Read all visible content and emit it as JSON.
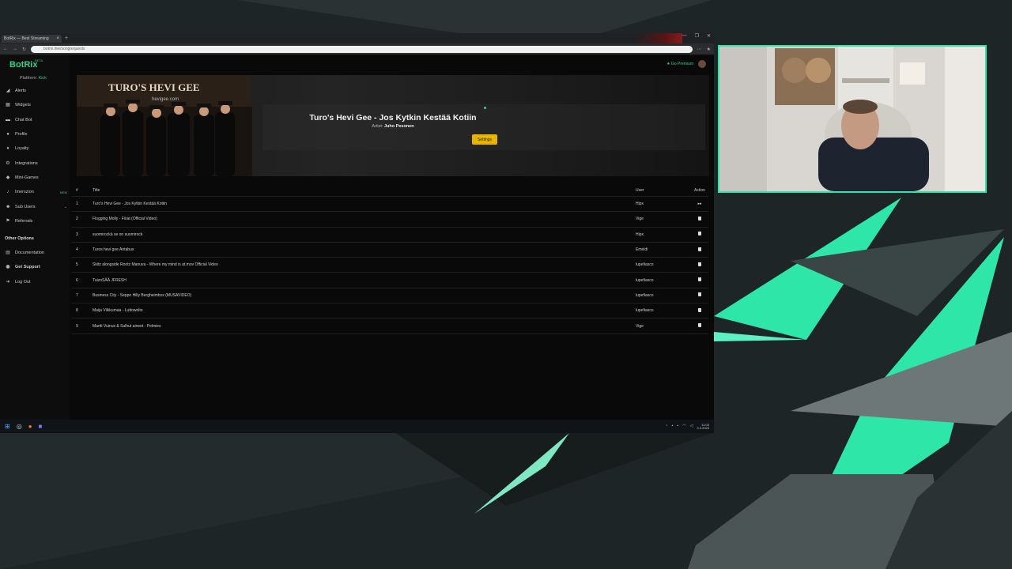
{
  "browser": {
    "tab_title": "BotRix — Best Streaming",
    "url": "botrix.live/songrequests",
    "new_tab": "+",
    "window_controls": [
      "—",
      "❐",
      "✕"
    ]
  },
  "app": {
    "logo": "BotRix",
    "beta": "BETA",
    "platform_label": "Platform:",
    "platform_value": "Kick",
    "go_premium": "★ Go Premium",
    "nav": [
      {
        "label": "Alerts",
        "icon": "megaphone-icon",
        "glyph": "◢"
      },
      {
        "label": "Widgets",
        "icon": "widgets-icon",
        "glyph": "▦"
      },
      {
        "label": "Chat Bot",
        "icon": "chat-icon",
        "glyph": "▬"
      },
      {
        "label": "Profile",
        "icon": "profile-icon",
        "glyph": "●"
      },
      {
        "label": "Loyalty",
        "icon": "loyalty-icon",
        "glyph": "♦"
      },
      {
        "label": "Integrations",
        "icon": "integrations-icon",
        "glyph": "⚙"
      },
      {
        "label": "Mini-Games",
        "icon": "gamepad-icon",
        "glyph": "◆"
      },
      {
        "label": "Imerszion",
        "icon": "music-icon",
        "glyph": "♪",
        "badge": "NEW"
      },
      {
        "label": "Sub Users",
        "icon": "users-icon",
        "glyph": "☻"
      },
      {
        "label": "Referrals",
        "icon": "referrals-icon",
        "glyph": "⚑"
      }
    ],
    "other_options_title": "Other Options",
    "other": [
      {
        "label": "Documentation",
        "icon": "document-icon",
        "glyph": "▤"
      },
      {
        "label": "Get Support",
        "icon": "support-icon",
        "glyph": "◉"
      },
      {
        "label": "Log Out",
        "icon": "logout-icon",
        "glyph": "➜"
      }
    ]
  },
  "now_playing": {
    "title": "Turo's Hevi Gee - Jos Kytkin Kestää Kotiin",
    "artist_label": "Artist:",
    "artist": "Juho Pesonen",
    "settings_button": "Settings",
    "cover_text": "TURO'S HEVI GEE",
    "cover_url": "hevigee.com"
  },
  "queue": {
    "headers": {
      "num": "#",
      "title": "Title",
      "user": "User",
      "action": "Action"
    },
    "rows": [
      {
        "num": "1",
        "title": "Turo's Hevi Gee - Jos Kytkin Kestää Kotiin",
        "user": "Hipx",
        "action": "skip"
      },
      {
        "num": "2",
        "title": "Flogging Molly - Float (Official Video)",
        "user": "Vige",
        "action": "delete"
      },
      {
        "num": "3",
        "title": "suomirockä se on suomirock",
        "user": "Hipx",
        "action": "delete"
      },
      {
        "num": "4",
        "title": "Turos hevi gee Antabus",
        "user": "Emeldi",
        "action": "delete"
      },
      {
        "num": "5",
        "title": "Skitz alongside Rootz Manuva - Where my mind is at.mov Official Video",
        "user": "lupefiasco",
        "action": "delete"
      },
      {
        "num": "6",
        "title": "TuizoSÄÄ JFRESH",
        "user": "lupefiasco",
        "action": "delete"
      },
      {
        "num": "7",
        "title": "Business City - Seppo Hilly Bergheimbox (MUSAVIDEO)",
        "user": "lupefiasco",
        "action": "delete"
      },
      {
        "num": "8",
        "title": "Maija Vilkkumaa - Luttowolto",
        "user": "lupefiasco",
        "action": "delete"
      },
      {
        "num": "9",
        "title": "Martti Vuinus & Sulhut aineet - Pelmies",
        "user": "Vige",
        "action": "delete"
      }
    ]
  },
  "taskbar": {
    "time": "11:03",
    "date": "3.3.2025"
  },
  "colors": {
    "accent": "#2fd38a",
    "button": "#e8b400",
    "overlay_green": "#2ee6a7"
  }
}
